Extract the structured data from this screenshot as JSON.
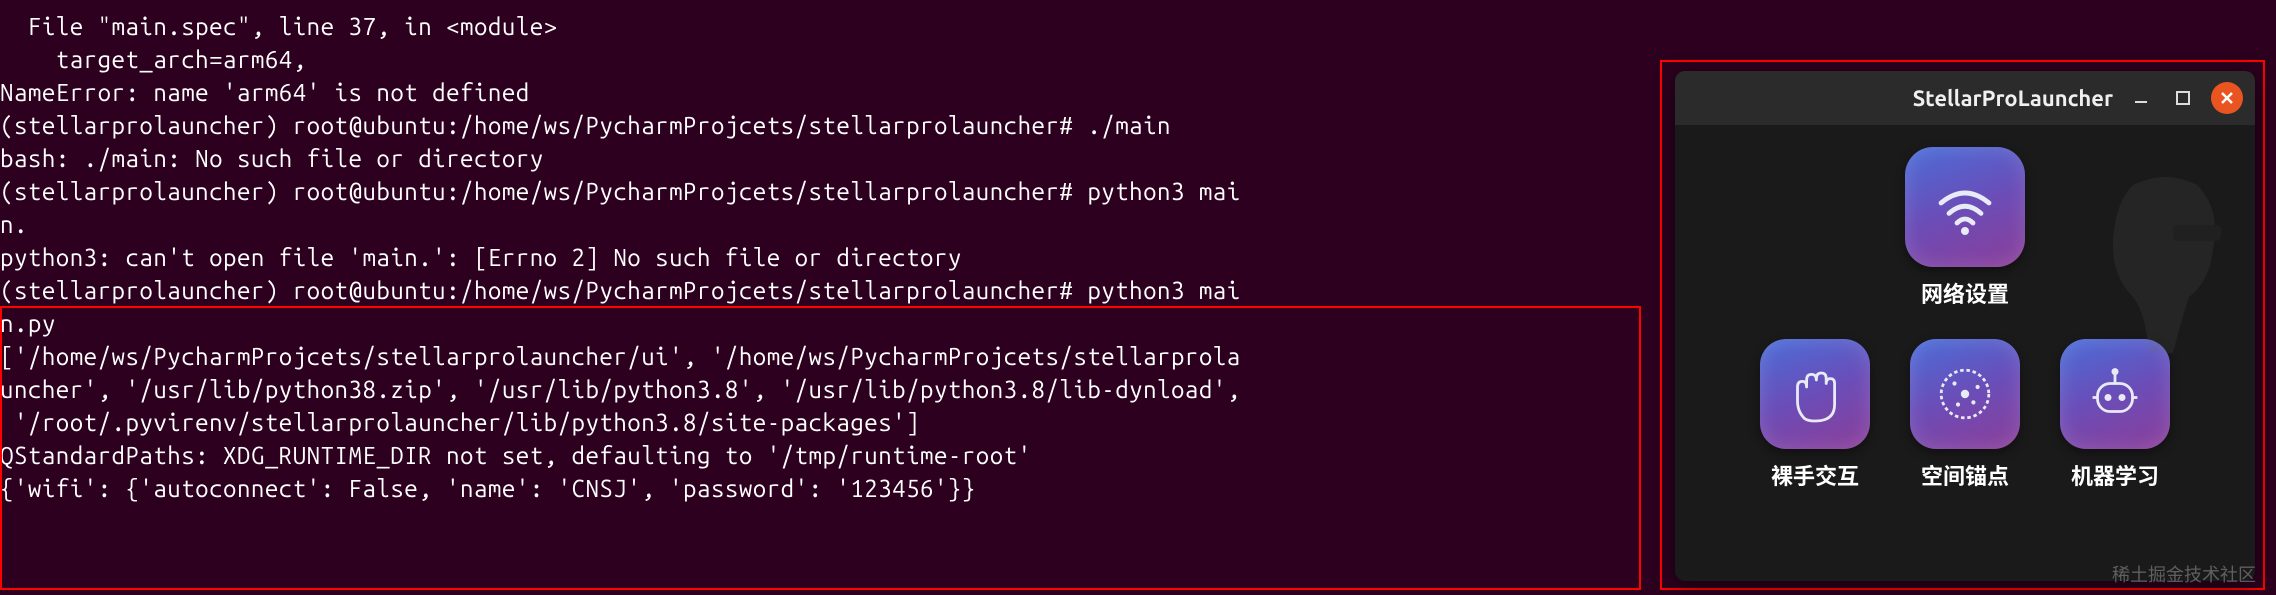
{
  "terminal": {
    "lines": [
      "  File \"main.spec\", line 37, in <module>",
      "    target_arch=arm64,",
      "NameError: name 'arm64' is not defined",
      "(stellarprolauncher) root@ubuntu:/home/ws/PycharmProjcets/stellarprolauncher# ./main",
      "bash: ./main: No such file or directory",
      "(stellarprolauncher) root@ubuntu:/home/ws/PycharmProjcets/stellarprolauncher# python3 mai",
      "n.",
      "python3: can't open file 'main.': [Errno 2] No such file or directory",
      "(stellarprolauncher) root@ubuntu:/home/ws/PycharmProjcets/stellarprolauncher# python3 mai",
      "n.py",
      "['/home/ws/PycharmProjcets/stellarprolauncher/ui', '/home/ws/PycharmProjcets/stellarprola",
      "uncher', '/usr/lib/python38.zip', '/usr/lib/python3.8', '/usr/lib/python3.8/lib-dynload',",
      " '/root/.pyvirenv/stellarprolauncher/lib/python3.8/site-packages']",
      "QStandardPaths: XDG_RUNTIME_DIR not set, defaulting to '/tmp/runtime-root'",
      "{'wifi': {'autoconnect': False, 'name': 'CNSJ', 'password': '123456'}}"
    ]
  },
  "app": {
    "title": "StellarProLauncher",
    "tiles": {
      "network": "网络设置",
      "hand": "裸手交互",
      "anchor": "空间锚点",
      "ml": "机器学习"
    }
  },
  "watermark": "稀土掘金技术社区"
}
